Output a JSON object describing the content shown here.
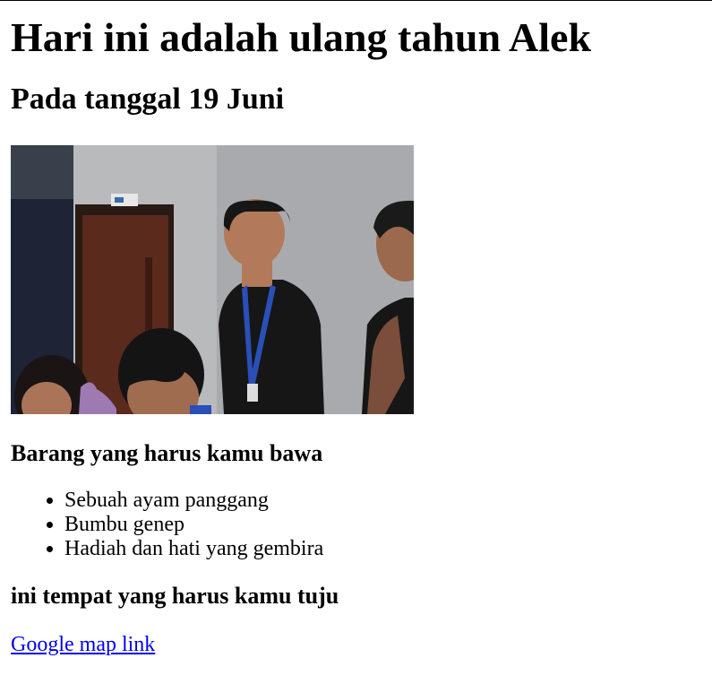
{
  "heading": "Hari ini adalah ulang tahun Alek",
  "subheading": "Pada tanggal 19 Juni",
  "photo": {
    "description_icon": "group-photo",
    "colors": {
      "wall": "#b9babc",
      "dark_left": "#1e2336",
      "door": "#5a2a1c",
      "shirt": "#161616",
      "skin": "#b27a5a",
      "lanyard": "#2a4fb8"
    }
  },
  "items_section": {
    "title": "Barang yang harus kamu bawa",
    "items": [
      "Sebuah ayam panggang",
      "Bumbu genep",
      "Hadiah dan hati yang gembira"
    ]
  },
  "location_section": {
    "title": "ini tempat yang harus kamu tuju",
    "link_text": "Google map link"
  },
  "colors": {
    "link": "#0000ee",
    "text": "#000000",
    "background": "#ffffff"
  }
}
